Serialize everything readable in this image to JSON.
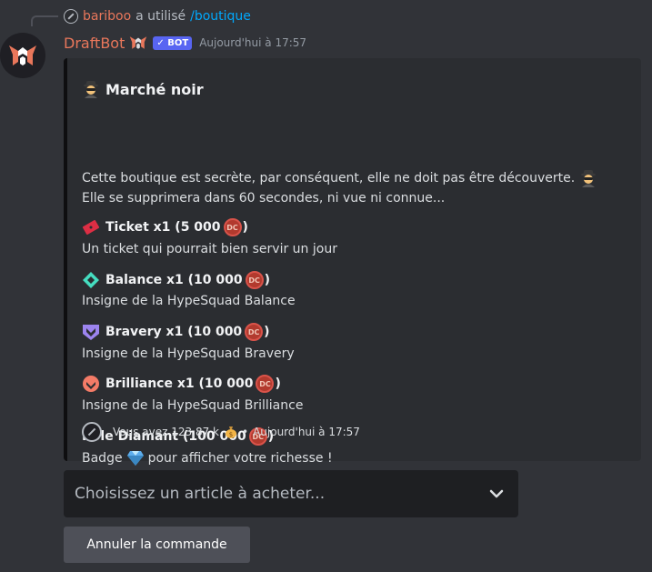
{
  "reply": {
    "username": "bariboo",
    "action": "a utilisé",
    "command": "/boutique"
  },
  "message": {
    "author": "DraftBot",
    "bot_tag": "✓ BOT",
    "timestamp": "Aujourd'hui à 17:57"
  },
  "embed": {
    "title": "Marché noir",
    "description_line1": "Cette boutique est secrète, par conséquent, elle ne doit pas être découverte.",
    "description_line2": "Elle se supprimera dans 60 secondes, ni vue ni connue...",
    "items": [
      {
        "name_before": "Ticket x1 (5 000",
        "name_after": ")",
        "description": "Un ticket qui pourrait bien servir un jour",
        "icon": "ticket-icon"
      },
      {
        "name_before": "Balance x1 (10 000",
        "name_after": ")",
        "description": "Insigne de la HypeSquad Balance",
        "icon": "hypesquad-balance-icon"
      },
      {
        "name_before": "Bravery x1 (10 000",
        "name_after": ")",
        "description": "Insigne de la HypeSquad Bravery",
        "icon": "hypesquad-bravery-icon"
      },
      {
        "name_before": "Brilliance x1 (10 000",
        "name_after": ")",
        "description": "Insigne de la HypeSquad Brilliance",
        "icon": "hypesquad-brilliance-icon"
      },
      {
        "name_before": "Rôle  Diamant (100 000",
        "name_after": ")",
        "description_before": "Badge",
        "description_after": "pour afficher votre richesse !",
        "icon": "diamond-icon"
      }
    ],
    "footer": {
      "balance_text": "Vous avez 123,87 k",
      "separator": "•",
      "timestamp": "Aujourd'hui à 17:57"
    },
    "coin_label": "DC"
  },
  "select": {
    "placeholder": "Choisissez un article à acheter..."
  },
  "cancel_button": {
    "label": "Annuler la commande"
  },
  "colors": {
    "background": "#313338",
    "embed_background": "#2b2d31",
    "username": "#e9775b",
    "link": "#00a8fc",
    "bot_tag": "#5865f2",
    "button": "#4e5058",
    "select_background": "#1e1f22"
  }
}
